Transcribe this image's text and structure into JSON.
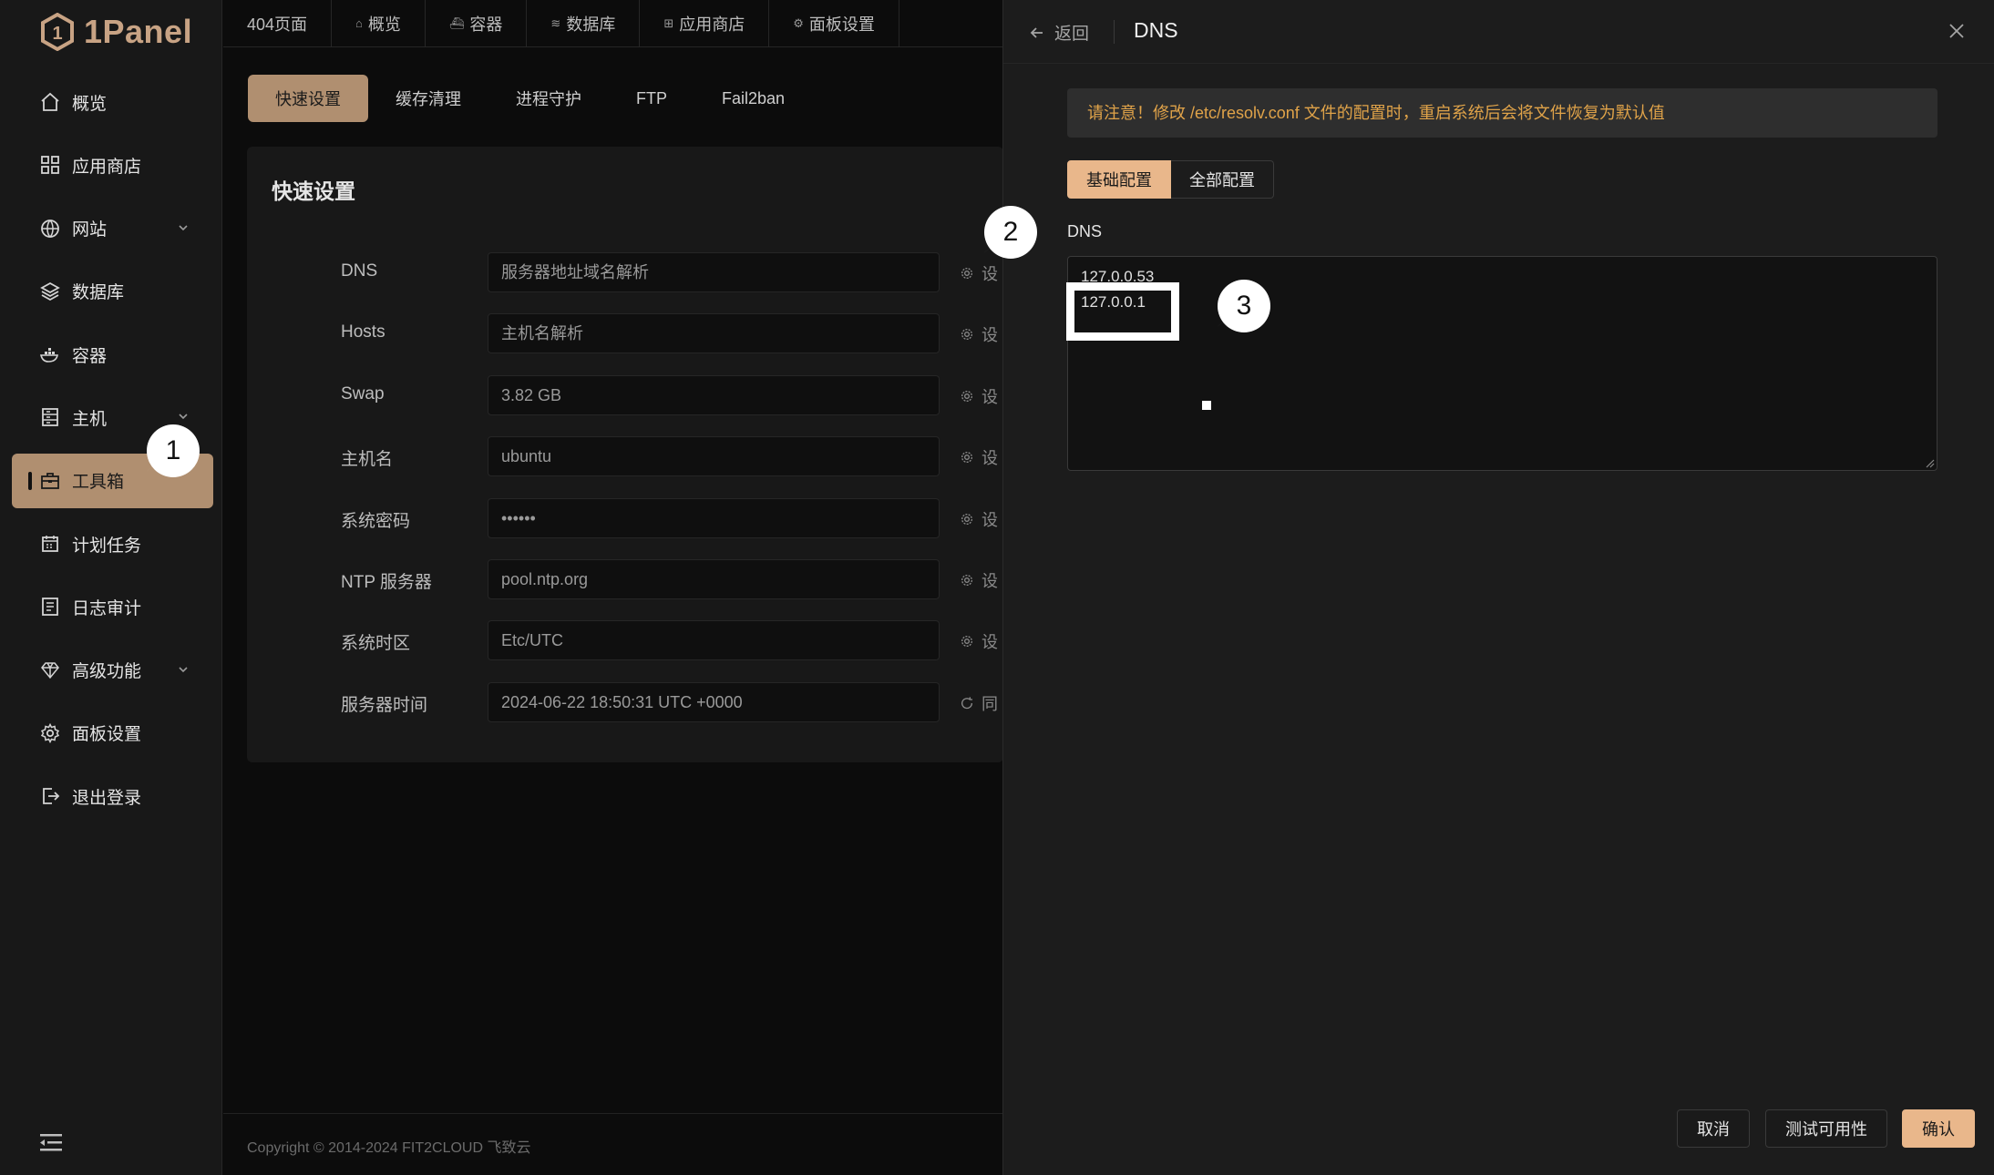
{
  "brand": {
    "name": "1Panel",
    "color": "#c8a384"
  },
  "sidebar": {
    "items": [
      {
        "label": "概览",
        "icon": "home-icon",
        "has_chevron": false
      },
      {
        "label": "应用商店",
        "icon": "grid-icon",
        "has_chevron": false
      },
      {
        "label": "网站",
        "icon": "globe-icon",
        "has_chevron": true
      },
      {
        "label": "数据库",
        "icon": "layers-icon",
        "has_chevron": false
      },
      {
        "label": "容器",
        "icon": "docker-icon",
        "has_chevron": false
      },
      {
        "label": "主机",
        "icon": "server-icon",
        "has_chevron": true
      },
      {
        "label": "工具箱",
        "icon": "toolbox-icon",
        "has_chevron": false,
        "active": true
      },
      {
        "label": "计划任务",
        "icon": "calendar-icon",
        "has_chevron": false
      },
      {
        "label": "日志审计",
        "icon": "log-icon",
        "has_chevron": false
      },
      {
        "label": "高级功能",
        "icon": "diamond-icon",
        "has_chevron": true
      },
      {
        "label": "面板设置",
        "icon": "gear-icon",
        "has_chevron": false
      },
      {
        "label": "退出登录",
        "icon": "logout-icon",
        "has_chevron": false
      }
    ]
  },
  "topbar": {
    "tabs": [
      {
        "label": "404页面",
        "icon": ""
      },
      {
        "label": "概览",
        "icon": "⌂"
      },
      {
        "label": "容器",
        "icon": "⛴"
      },
      {
        "label": "数据库",
        "icon": "≋"
      },
      {
        "label": "应用商店",
        "icon": "⊞"
      },
      {
        "label": "面板设置",
        "icon": "⚙"
      }
    ]
  },
  "subtabs": [
    "快速设置",
    "缓存清理",
    "进程守护",
    "FTP",
    "Fail2ban"
  ],
  "card": {
    "title": "快速设置",
    "rows": [
      {
        "label": "DNS",
        "value": "服务器地址域名解析",
        "action": "设"
      },
      {
        "label": "Hosts",
        "value": "主机名解析",
        "action": "设"
      },
      {
        "label": "Swap",
        "value": "3.82 GB",
        "action": "设"
      },
      {
        "label": "主机名",
        "value": "ubuntu",
        "action": "设"
      },
      {
        "label": "系统密码",
        "value": "••••••",
        "action": "设"
      },
      {
        "label": "NTP 服务器",
        "value": "pool.ntp.org",
        "action": "设"
      },
      {
        "label": "系统时区",
        "value": "Etc/UTC",
        "action": "设"
      },
      {
        "label": "服务器时间",
        "value": "2024-06-22 18:50:31 UTC +0000",
        "action": "同"
      }
    ]
  },
  "footer": {
    "copyright": "Copyright © 2014-2024 FIT2CLOUD 飞致云"
  },
  "drawer": {
    "back_label": "返回",
    "title": "DNS",
    "notice": "请注意！修改 /etc/resolv.conf 文件的配置时，重启系统后会将文件恢复为默认值",
    "mode_tabs": [
      "基础配置",
      "全部配置"
    ],
    "field_label": "DNS",
    "dns_lines": [
      "127.0.0.53",
      "127.0.0.1"
    ],
    "buttons": {
      "cancel": "取消",
      "test": "测试可用性",
      "confirm": "确认"
    }
  },
  "annotations": [
    "1",
    "2",
    "3"
  ],
  "colors": {
    "accent": "#b08f70",
    "accent_light": "#e9b78b",
    "warning": "#e0a349"
  }
}
